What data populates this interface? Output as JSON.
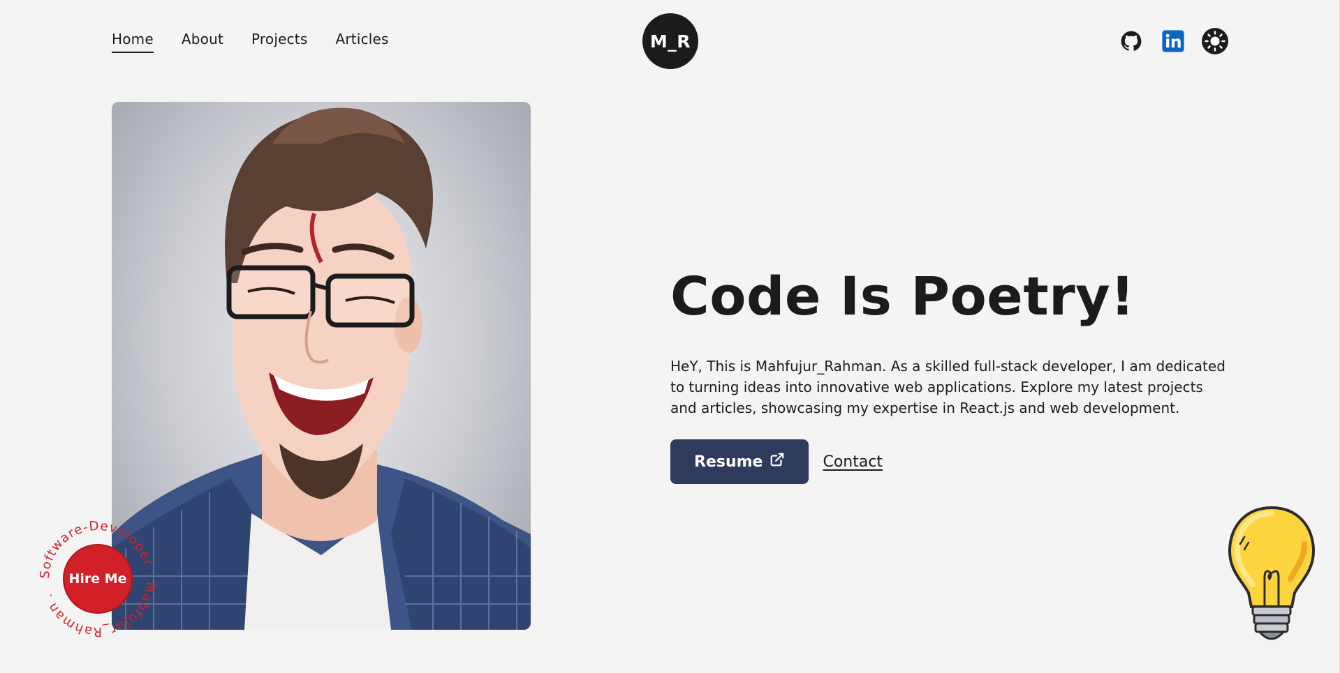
{
  "nav": {
    "items": [
      {
        "label": "Home",
        "active": true
      },
      {
        "label": "About",
        "active": false
      },
      {
        "label": "Projects",
        "active": false
      },
      {
        "label": "Articles",
        "active": false
      }
    ]
  },
  "logo": {
    "text": "M_R"
  },
  "social": {
    "icons": [
      "github-icon",
      "linkedin-icon",
      "theme-toggle-sun-icon"
    ]
  },
  "hero": {
    "title": "Code Is Poetry!",
    "description": "HeY, This is Mahfujur_Rahman. As a skilled full-stack developer, I am dedicated to turning ideas into innovative web applications. Explore my latest projects and articles, showcasing my expertise in React.js and web development.",
    "resume_label": "Resume",
    "contact_label": "Contact"
  },
  "hire": {
    "label": "Hire Me",
    "ring_text": "Software-Developer . Mahfujur_Rahman ."
  },
  "colors": {
    "background": "#f4f4f4",
    "text": "#1b1b1b",
    "resume_button": "#2e3b5d",
    "hire_button": "#d32028",
    "linkedin": "#0a66c2"
  }
}
